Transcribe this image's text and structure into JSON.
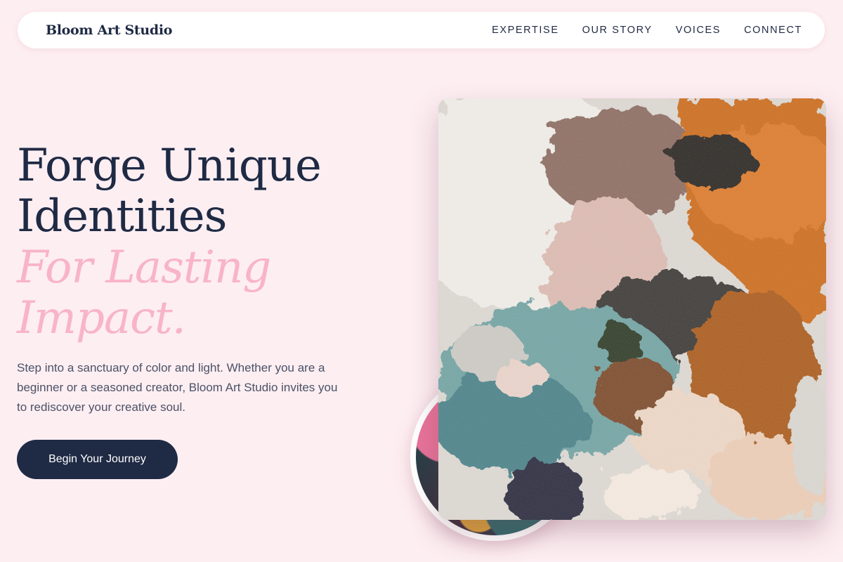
{
  "nav": {
    "brand": "Bloom Art Studio",
    "links": [
      "EXPERTISE",
      "OUR STORY",
      "VOICES",
      "CONNECT"
    ]
  },
  "hero": {
    "title_lines": [
      "Forge Unique",
      "Identities"
    ],
    "accent_lines": [
      "For Lasting",
      "Impact."
    ],
    "description": "Step into a sanctuary of color and light. Whether you are a beginner or a seasoned creator, Bloom Art Studio invites you to rediscover your creative soul.",
    "cta_label": "Begin Your Journey"
  },
  "colors": {
    "background": "#fdeef2",
    "primary": "#1f2a44",
    "accent": "#f8b4c8"
  }
}
